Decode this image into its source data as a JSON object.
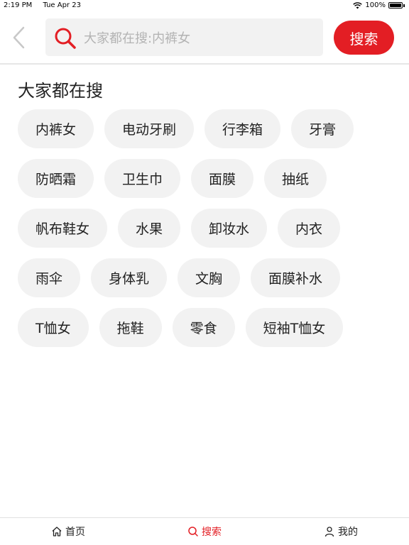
{
  "status_bar": {
    "time": "2:19 PM",
    "date": "Tue Apr 23",
    "battery": "100%"
  },
  "header": {
    "search_placeholder": "大家都在搜:内裤女",
    "search_button": "搜索"
  },
  "section_title": "大家都在搜",
  "tags": [
    [
      "内裤女",
      "电动牙刷",
      "行李箱",
      "牙膏"
    ],
    [
      "防晒霜",
      "卫生巾",
      "面膜",
      "抽纸"
    ],
    [
      "帆布鞋女",
      "水果",
      "卸妆水",
      "内衣"
    ],
    [
      "雨伞",
      "身体乳",
      "文胸",
      "面膜补水"
    ],
    [
      "T恤女",
      "拖鞋",
      "零食",
      "短袖T恤女"
    ]
  ],
  "tabbar": {
    "home": "首页",
    "search": "搜索",
    "mine": "我的"
  },
  "colors": {
    "accent": "#e31e24",
    "tag_bg": "#f2f2f2"
  },
  "icons": [
    "back-icon",
    "search-icon",
    "wifi-icon",
    "battery-icon",
    "home-icon",
    "user-icon"
  ]
}
